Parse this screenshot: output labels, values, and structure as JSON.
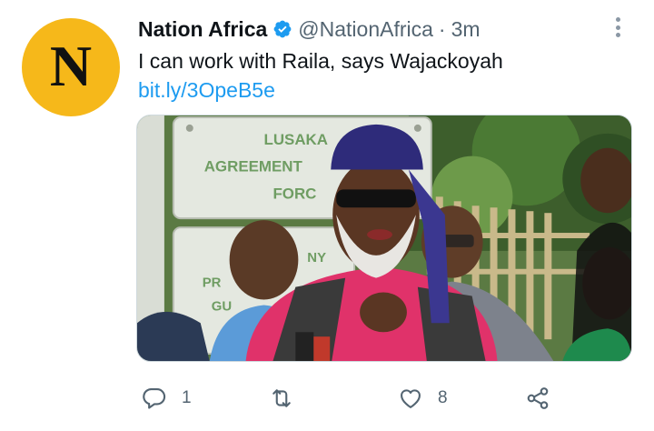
{
  "tweet": {
    "author_name": "Nation Africa",
    "handle": "@NationAfrica",
    "separator": "·",
    "time": "3m",
    "text": "I can work with Raila, says Wajackoyah",
    "link": "bit.ly/3OpeB5e"
  },
  "avatar": {
    "letter": "N",
    "color": "#f6b81a"
  },
  "media": {
    "sign_lines": [
      "LUSAKA",
      "AGREEMENT",
      "FORC"
    ],
    "sign2_lines": [
      "NY",
      "PR",
      "GU"
    ],
    "description": ""
  },
  "actions": {
    "reply_count": "1",
    "retweet_count": "",
    "like_count": "8"
  },
  "icons": {
    "verified": "verified-badge-icon",
    "more": "more-vertical-icon",
    "reply": "reply-icon",
    "retweet": "retweet-icon",
    "like": "like-icon",
    "share": "share-icon"
  },
  "colors": {
    "link": "#1d9bf0",
    "secondary_text": "#536471",
    "verified": "#1d9bf0"
  }
}
